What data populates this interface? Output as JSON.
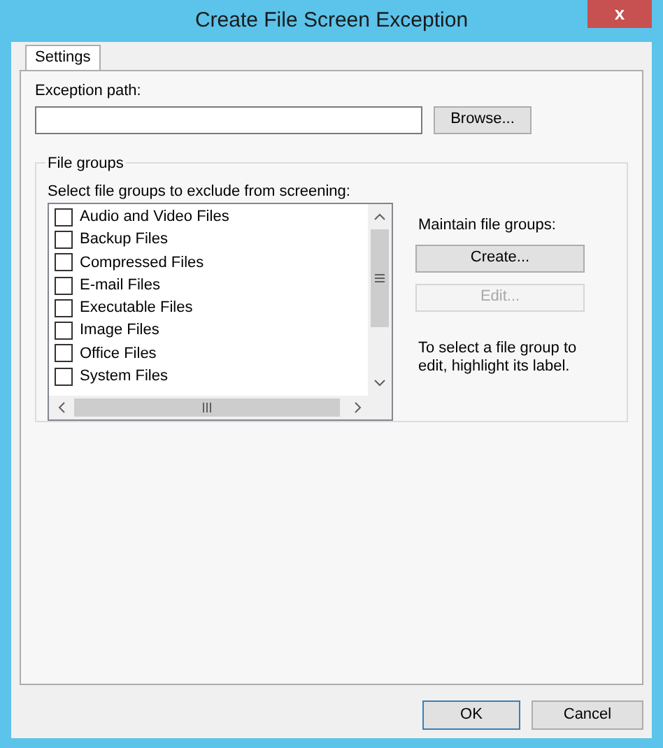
{
  "window": {
    "title": "Create File Screen Exception",
    "close": "x"
  },
  "tabs": [
    {
      "label": "Settings",
      "selected": true
    }
  ],
  "exception_path": {
    "label": "Exception path:",
    "browse": "Browse..."
  },
  "file_groups": {
    "title": "File groups",
    "list_label": "Select file groups to exclude from screening:",
    "items": [
      {
        "label": "Audio and Video Files",
        "checked": false
      },
      {
        "label": "Backup Files",
        "checked": false
      },
      {
        "label": "Compressed Files",
        "checked": false
      },
      {
        "label": "E-mail Files",
        "checked": false
      },
      {
        "label": "Executable Files",
        "checked": false
      },
      {
        "label": "Image Files",
        "checked": false
      },
      {
        "label": "Office Files",
        "checked": false
      },
      {
        "label": "System Files",
        "checked": false
      }
    ],
    "maintain_label": "Maintain file groups:",
    "buttons": [
      {
        "label": "Create...",
        "disabled": false
      },
      {
        "label": "Edit...",
        "disabled": true
      }
    ],
    "hint": "To select a file group to edit, highlight its label."
  },
  "buttons": [
    "OK",
    "Cancel"
  ]
}
